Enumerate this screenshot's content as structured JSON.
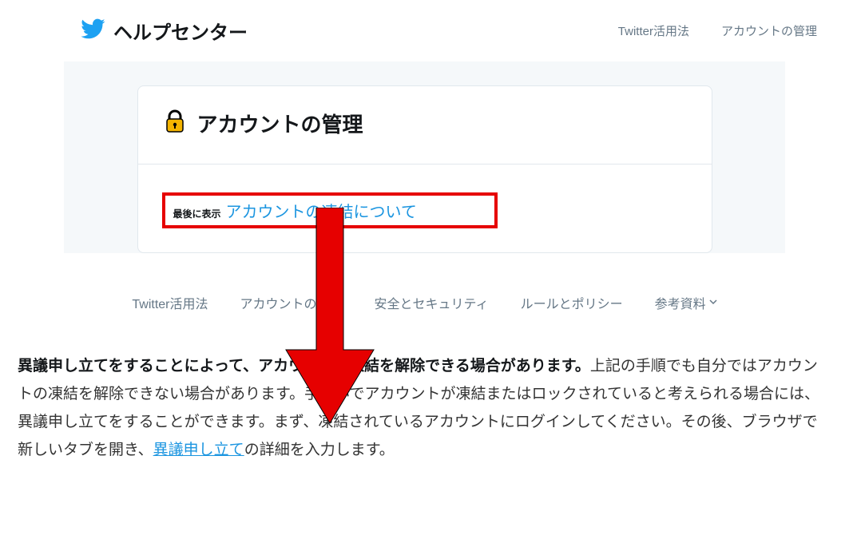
{
  "header": {
    "title": "ヘルプセンター",
    "nav": [
      {
        "label": "Twitter活用法"
      },
      {
        "label": "アカウントの管理"
      }
    ]
  },
  "card": {
    "title": "アカウントの管理",
    "last_viewed_label": "最後に表示",
    "highlighted_link": "アカウントの凍結について"
  },
  "sub_nav": {
    "items": [
      {
        "label": "Twitter活用法"
      },
      {
        "label": "アカウントの管理"
      },
      {
        "label": "安全とセキュリティ"
      },
      {
        "label": "ルールとポリシー"
      },
      {
        "label": "参考資料",
        "dropdown": true
      }
    ]
  },
  "paragraph": {
    "bold": "異議申し立てをすることによって、アカウントの凍結を解除できる場合があります。",
    "text1": "上記の手順でも自分ではアカウントの凍結を解除できない場合があります。手違いでアカウントが凍結またはロックされていると考えられる場合には、異議申し立てをすることができます。まず、凍結されているアカウントにログインしてください。その後、ブラウザで新しいタブを開き、",
    "link": "異議申し立て",
    "text2": "の詳細を入力します。"
  }
}
